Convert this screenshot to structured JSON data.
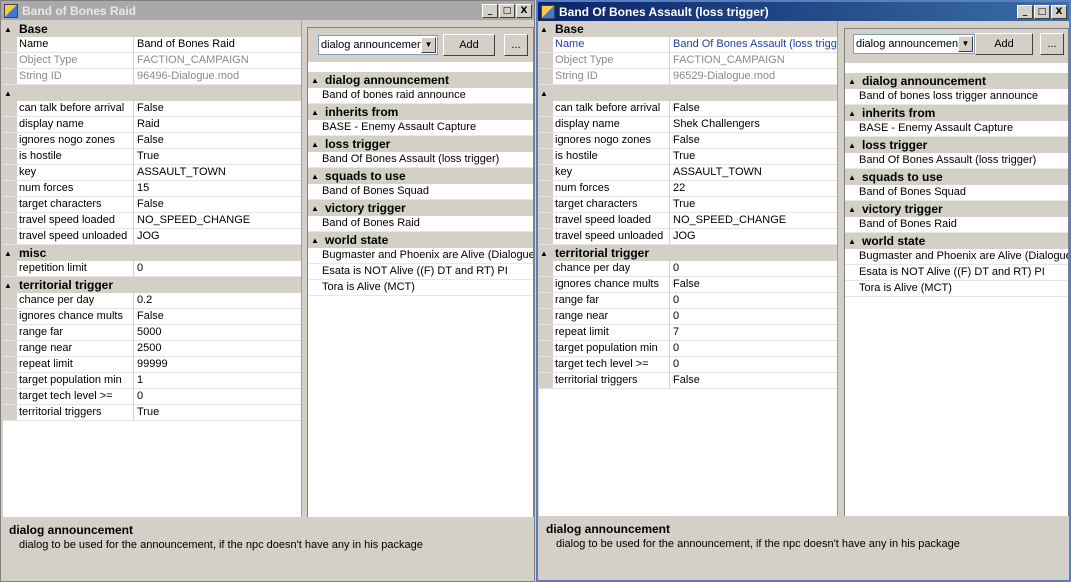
{
  "left": {
    "title": "Band of Bones Raid",
    "sections": [
      {
        "cat": "Base",
        "rows": [
          {
            "k": "Name",
            "v": "Band of Bones Raid",
            "style": ""
          },
          {
            "k": "Object Type",
            "v": "FACTION_CAMPAIGN",
            "style": "ro"
          },
          {
            "k": "String ID",
            "v": "96496-Dialogue.mod",
            "style": "ro"
          }
        ]
      },
      {
        "cat": "",
        "rows": [
          {
            "k": "can talk before arrival",
            "v": "False"
          },
          {
            "k": "display name",
            "v": "Raid"
          },
          {
            "k": "ignores nogo zones",
            "v": "False"
          },
          {
            "k": "is hostile",
            "v": "True"
          },
          {
            "k": "key",
            "v": "ASSAULT_TOWN"
          },
          {
            "k": "num forces",
            "v": "15"
          },
          {
            "k": "target characters",
            "v": "False"
          },
          {
            "k": "travel speed loaded",
            "v": "NO_SPEED_CHANGE"
          },
          {
            "k": "travel speed unloaded",
            "v": "JOG"
          }
        ]
      },
      {
        "cat": "misc",
        "rows": [
          {
            "k": "repetition limit",
            "v": "0"
          }
        ]
      },
      {
        "cat": "territorial trigger",
        "rows": [
          {
            "k": "chance per day",
            "v": "0.2"
          },
          {
            "k": "ignores chance mults",
            "v": "False"
          },
          {
            "k": "range far",
            "v": "5000"
          },
          {
            "k": "range near",
            "v": "2500"
          },
          {
            "k": "repeat limit",
            "v": "99999"
          },
          {
            "k": "target population min",
            "v": "1"
          },
          {
            "k": "target tech level >=",
            "v": "0"
          },
          {
            "k": "territorial triggers",
            "v": "True"
          }
        ]
      }
    ],
    "combo": "dialog announcement",
    "add": "Add",
    "more": "...",
    "refs": [
      {
        "cat": "dialog announcement",
        "items": [
          "Band of bones raid announce"
        ]
      },
      {
        "cat": "inherits from",
        "items": [
          "BASE - Enemy Assault Capture"
        ]
      },
      {
        "cat": "loss trigger",
        "items": [
          "Band Of Bones Assault (loss trigger)"
        ]
      },
      {
        "cat": "squads to use",
        "items": [
          "Band of Bones Squad"
        ]
      },
      {
        "cat": "victory trigger",
        "items": [
          "Band of Bones Raid"
        ]
      },
      {
        "cat": "world state",
        "items": [
          "Bugmaster and Phoenix are Alive (Dialogue and",
          "Esata is NOT Alive ((F) DT and RT) PI",
          "Tora is Alive (MCT)"
        ]
      }
    ],
    "help_title": "dialog announcement",
    "help_desc": "dialog to be used for the announcement, if the npc doesn't have any in his package"
  },
  "right": {
    "title": "Band Of Bones Assault (loss trigger)",
    "sections": [
      {
        "cat": "Base",
        "rows": [
          {
            "k": "Name",
            "v": "Band Of Bones Assault (loss trigger)",
            "style": "sel"
          },
          {
            "k": "Object Type",
            "v": "FACTION_CAMPAIGN",
            "style": "ro"
          },
          {
            "k": "String ID",
            "v": "96529-Dialogue.mod",
            "style": "ro"
          }
        ]
      },
      {
        "cat": "",
        "rows": [
          {
            "k": "can talk before arrival",
            "v": "False"
          },
          {
            "k": "display name",
            "v": "Shek Challengers"
          },
          {
            "k": "ignores nogo zones",
            "v": "False"
          },
          {
            "k": "is hostile",
            "v": "True"
          },
          {
            "k": "key",
            "v": "ASSAULT_TOWN"
          },
          {
            "k": "num forces",
            "v": "22"
          },
          {
            "k": "target characters",
            "v": "True"
          },
          {
            "k": "travel speed loaded",
            "v": "NO_SPEED_CHANGE"
          },
          {
            "k": "travel speed unloaded",
            "v": "JOG"
          }
        ]
      },
      {
        "cat": "territorial trigger",
        "rows": [
          {
            "k": "chance per day",
            "v": "0"
          },
          {
            "k": "ignores chance mults",
            "v": "False"
          },
          {
            "k": "range far",
            "v": "0"
          },
          {
            "k": "range near",
            "v": "0"
          },
          {
            "k": "repeat limit",
            "v": "7"
          },
          {
            "k": "target population min",
            "v": "0"
          },
          {
            "k": "target tech level >=",
            "v": "0"
          },
          {
            "k": "territorial triggers",
            "v": "False"
          }
        ]
      }
    ],
    "combo": "dialog announcement",
    "add": "Add",
    "more": "...",
    "refs": [
      {
        "cat": "dialog announcement",
        "items": [
          "Band of bones loss trigger announce"
        ]
      },
      {
        "cat": "inherits from",
        "items": [
          "BASE - Enemy Assault Capture"
        ]
      },
      {
        "cat": "loss trigger",
        "items": [
          "Band Of Bones Assault (loss trigger)"
        ]
      },
      {
        "cat": "squads to use",
        "items": [
          "Band of Bones Squad"
        ]
      },
      {
        "cat": "victory trigger",
        "items": [
          "Band of Bones Raid"
        ]
      },
      {
        "cat": "world state",
        "items": [
          "Bugmaster and Phoenix are Alive (Dialogue and",
          "Esata is NOT Alive ((F) DT and RT) PI",
          "Tora is Alive (MCT)"
        ]
      }
    ],
    "help_title": "dialog announcement",
    "help_desc": "dialog to be used for the announcement, if the npc doesn't have any in his package"
  },
  "window_controls": {
    "minimize": "_",
    "maximize": "□",
    "close": "X"
  },
  "colors": {
    "active_title": "#0a246a",
    "inactive_title": "#a9a9a9",
    "face": "#d4d0c8"
  }
}
